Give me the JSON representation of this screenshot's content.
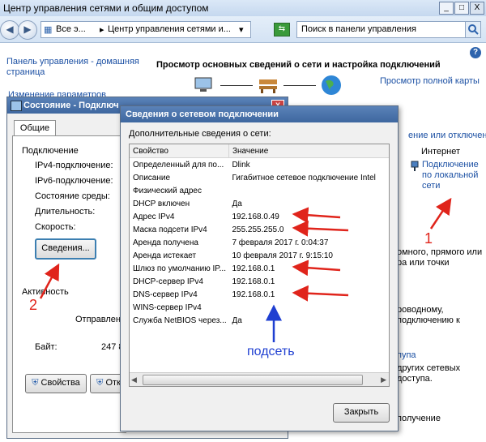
{
  "main": {
    "title": "Центр управления сетями и общим доступом",
    "win_min": "_",
    "win_max": "□",
    "win_close": "X",
    "breadcrumb_prefix": "Все э...",
    "breadcrumb_current": "Центр управления сетями и...",
    "search_placeholder": "Поиск в панели управления",
    "sidebar_link_home": "Панель управления - домашняя страница",
    "sidebar_link_change": "Изменение параметров",
    "heading": "Просмотр основных сведений о сети и настройка подключений",
    "full_map_link": "Просмотр полной карты",
    "connect_link": "ение или отключение",
    "internet_label": "Интернет",
    "lan_link": "Подключение по локальной сети",
    "right_text_1": "омного, прямого или",
    "right_text_2": "ра или точки",
    "right_text_3": "роводному,",
    "right_text_4": "подключению к",
    "right_text_5": "пупа",
    "right_text_6": "других сетевых",
    "right_text_7": "доступа.",
    "right_text_8": "получение"
  },
  "status": {
    "title": "Состояние - Подключ",
    "tab_general": "Общие",
    "section_connection": "Подключение",
    "ipv4": "IPv4-подключение:",
    "ipv6": "IPv6-подключение:",
    "media": "Состояние среды:",
    "duration": "Длительность:",
    "speed": "Скорость:",
    "details_button": "Сведения...",
    "section_activity": "Активность",
    "sent": "Отправлен",
    "bytes_label": "Байт:",
    "bytes_value": "247 8",
    "properties_button": "Свойства",
    "disable_button": "Отк"
  },
  "details": {
    "title": "Сведения о сетевом подключении",
    "subtitle": "Дополнительные сведения о сети:",
    "col_property": "Свойство",
    "col_value": "Значение",
    "rows": [
      {
        "p": "Определенный для по...",
        "v": "Dlink"
      },
      {
        "p": "Описание",
        "v": "Гигабитное сетевое подключение Intel"
      },
      {
        "p": "Физический адрес",
        "v": ""
      },
      {
        "p": "DHCP включен",
        "v": "Да"
      },
      {
        "p": "Адрес IPv4",
        "v": "192.168.0.49"
      },
      {
        "p": "Маска подсети IPv4",
        "v": "255.255.255.0"
      },
      {
        "p": "Аренда получена",
        "v": "7 февраля 2017 г. 0:04:37"
      },
      {
        "p": "Аренда истекает",
        "v": "10 февраля 2017 г. 9:15:10"
      },
      {
        "p": "Шлюз по умолчанию IP...",
        "v": "192.168.0.1"
      },
      {
        "p": "DHCP-сервер IPv4",
        "v": "192.168.0.1"
      },
      {
        "p": "DNS-сервер IPv4",
        "v": "192.168.0.1"
      },
      {
        "p": "WINS-сервер IPv4",
        "v": ""
      },
      {
        "p": "Служба NetBIOS через...",
        "v": "Да"
      }
    ],
    "close_button": "Закрыть"
  },
  "annotations": {
    "subnet": "подсеть",
    "num1": "1",
    "num2": "2",
    "red": "#e0241b",
    "blue": "#1f3fd1"
  }
}
